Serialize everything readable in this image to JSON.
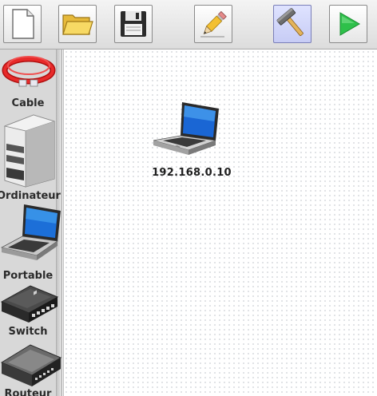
{
  "toolbar": {
    "buttons": [
      {
        "name": "new-document",
        "icon": "blank-page-icon",
        "active": false
      },
      {
        "name": "open-folder",
        "icon": "folder-icon",
        "active": false
      },
      {
        "name": "save",
        "icon": "floppy-disk-icon",
        "active": false
      },
      {
        "name": "edit",
        "icon": "pencil-icon",
        "active": false
      },
      {
        "name": "build",
        "icon": "hammer-icon",
        "active": true
      },
      {
        "name": "run",
        "icon": "play-icon",
        "active": false
      }
    ]
  },
  "palette": {
    "items": [
      {
        "label": "Cable",
        "icon": "ethernet-cable-icon"
      },
      {
        "label": "Ordinateur",
        "icon": "desktop-tower-icon"
      },
      {
        "label": "Portable",
        "icon": "laptop-icon"
      },
      {
        "label": "Switch",
        "icon": "network-switch-icon"
      },
      {
        "label": "Routeur",
        "icon": "router-icon"
      }
    ]
  },
  "canvas": {
    "nodes": [
      {
        "type": "laptop",
        "label": "192.168.0.10",
        "icon": "laptop-icon"
      }
    ]
  },
  "colors": {
    "toolbar_bg": "#e8e8e8",
    "sidebar_bg": "#d8d8d8",
    "active_button": "#c7ccf5",
    "play_green": "#2ec04a",
    "cable_red": "#d81818"
  }
}
